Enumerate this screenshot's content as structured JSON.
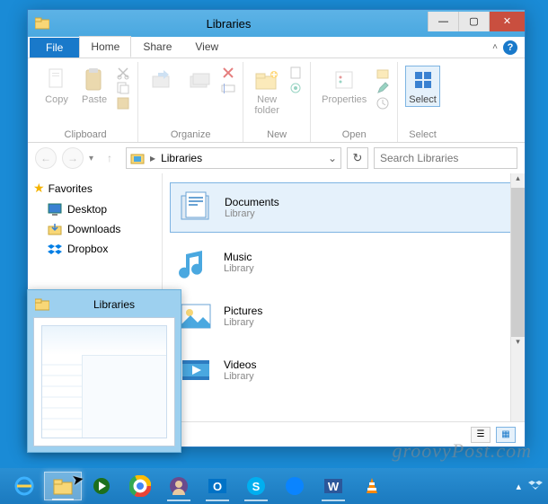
{
  "window": {
    "title": "Libraries",
    "controls": {
      "min": "—",
      "max": "▢",
      "close": "✕"
    }
  },
  "tabs": {
    "file": "File",
    "items": [
      "Home",
      "Share",
      "View"
    ],
    "active": 0
  },
  "ribbon": {
    "clipboard": {
      "label": "Clipboard",
      "copy": "Copy",
      "paste": "Paste"
    },
    "organize": {
      "label": "Organize"
    },
    "new": {
      "label": "New",
      "newfolder": "New\nfolder"
    },
    "open": {
      "label": "Open",
      "properties": "Properties"
    },
    "select": {
      "label": "Select",
      "select": "Select"
    }
  },
  "address": {
    "path": "Libraries",
    "search_placeholder": "Search Libraries"
  },
  "sidebar": {
    "favorites": "Favorites",
    "items": [
      {
        "label": "Desktop",
        "icon": "desktop"
      },
      {
        "label": "Downloads",
        "icon": "downloads"
      },
      {
        "label": "Dropbox",
        "icon": "dropbox"
      }
    ]
  },
  "libraries": [
    {
      "name": "Documents",
      "sub": "Library",
      "icon": "documents",
      "selected": true
    },
    {
      "name": "Music",
      "sub": "Library",
      "icon": "music",
      "selected": false
    },
    {
      "name": "Pictures",
      "sub": "Library",
      "icon": "pictures",
      "selected": false
    },
    {
      "name": "Videos",
      "sub": "Library",
      "icon": "videos",
      "selected": false
    }
  ],
  "thumbnail": {
    "title": "Libraries"
  },
  "taskbar": {
    "items": [
      {
        "name": "ie",
        "active": false
      },
      {
        "name": "explorer",
        "active": true,
        "running": true
      },
      {
        "name": "player",
        "active": false
      },
      {
        "name": "chrome",
        "active": false
      },
      {
        "name": "avatar",
        "active": false,
        "running": true
      },
      {
        "name": "outlook",
        "active": false,
        "running": true
      },
      {
        "name": "skype",
        "active": false,
        "running": true
      },
      {
        "name": "firefox",
        "active": false
      },
      {
        "name": "word",
        "active": false,
        "running": true
      },
      {
        "name": "vlc",
        "active": false
      }
    ]
  },
  "watermark": "groovyPost.com"
}
